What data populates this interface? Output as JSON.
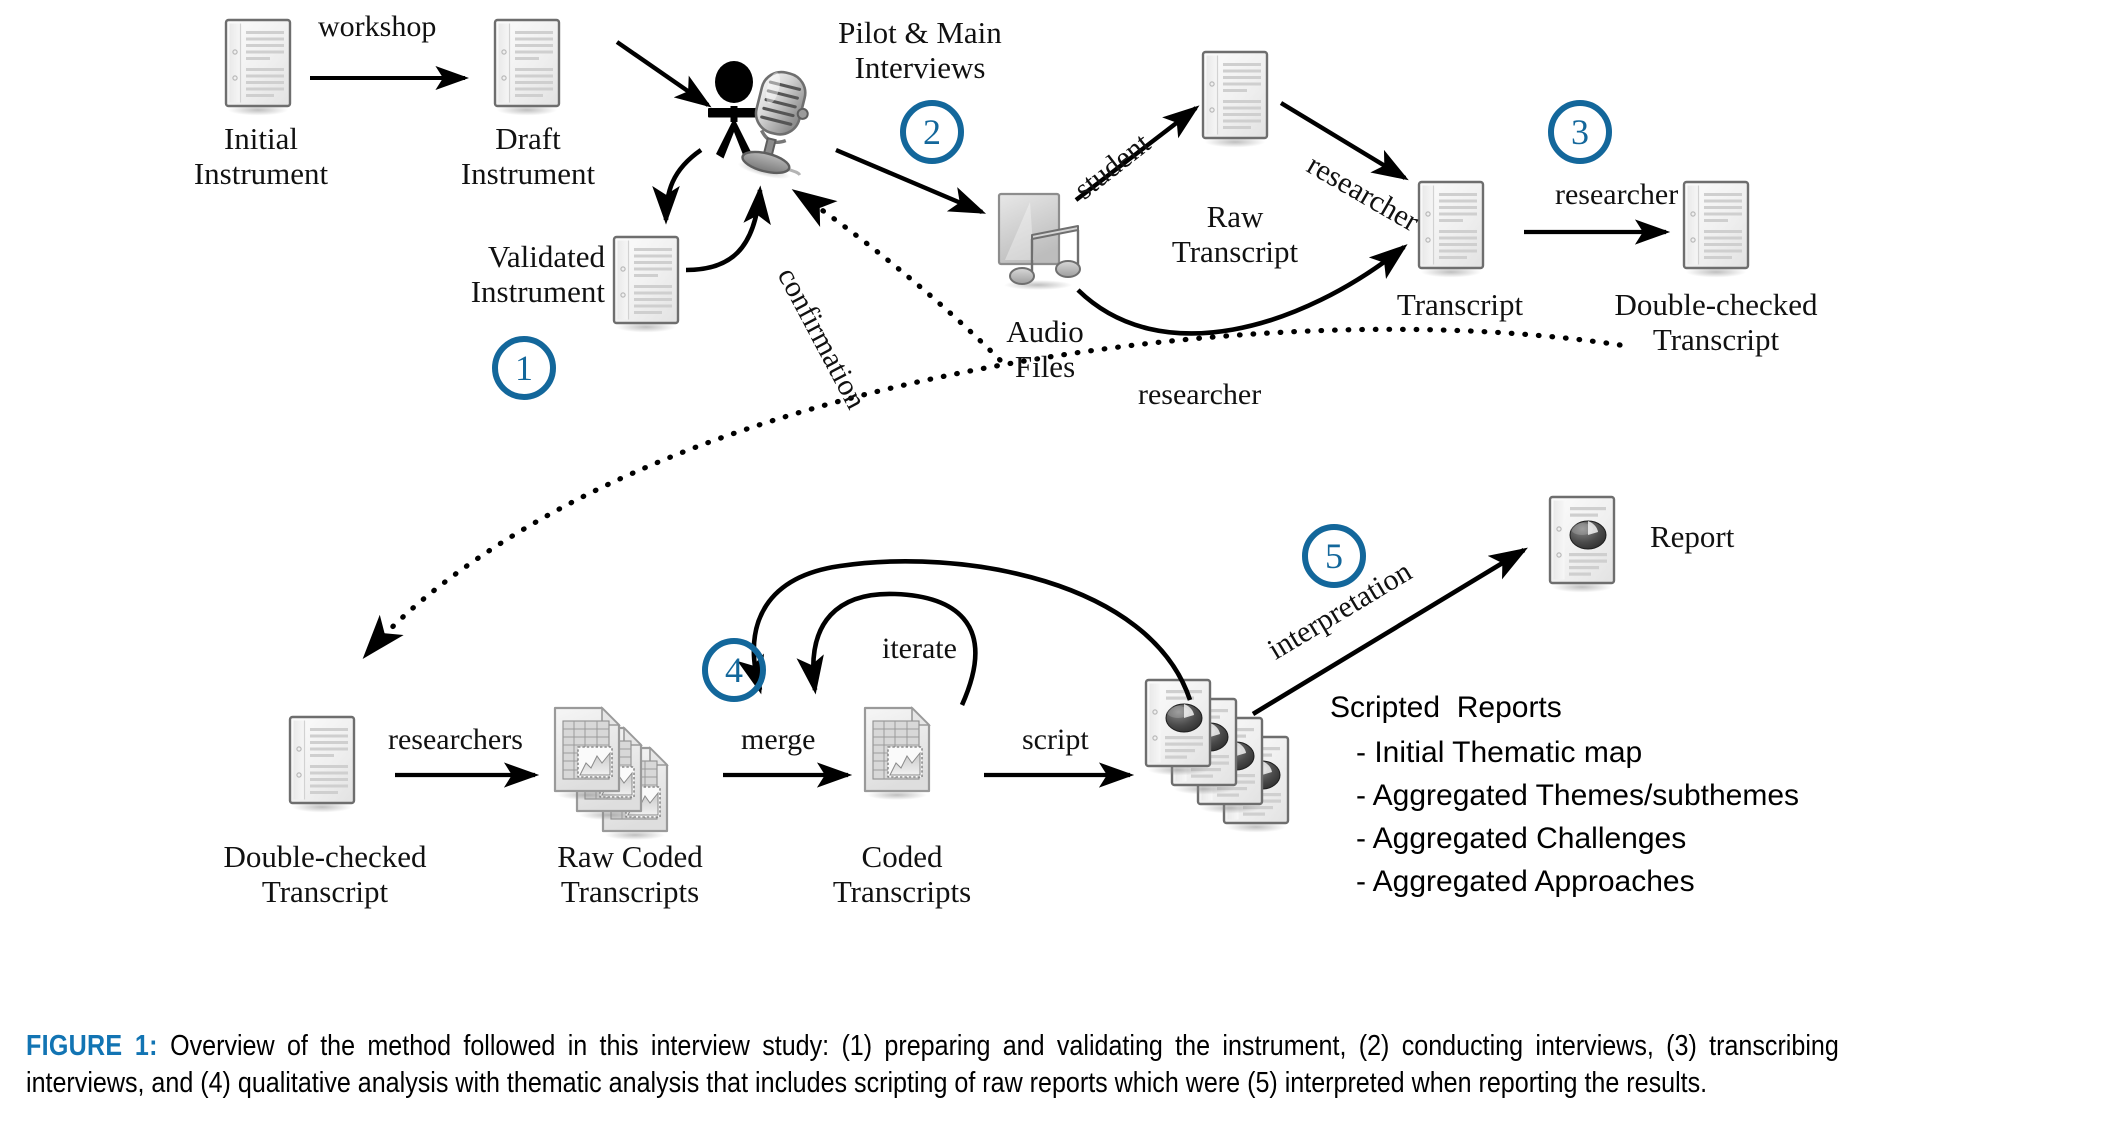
{
  "figure": {
    "label": "FIGURE 1:",
    "caption": " Overview of the method followed in this interview study: (1) preparing and validating the instrument, (2) conducting interviews, (3) transcribing interviews, and (4) qualitative analysis with thematic analysis that includes scripting of raw reports which were (5) interpreted when reporting the results.",
    "label_color": "#1274B3"
  },
  "colors": {
    "accent_blue": "#13679B",
    "stroke": "#000000",
    "doc_fill": "#f2f2f2",
    "doc_border": "#6b6b6b"
  },
  "steps": [
    {
      "id": "step-1",
      "number": "1"
    },
    {
      "id": "step-2",
      "number": "2"
    },
    {
      "id": "step-3",
      "number": "3"
    },
    {
      "id": "step-4",
      "number": "4"
    },
    {
      "id": "step-5",
      "number": "5"
    }
  ],
  "nodes": [
    {
      "id": "initial-instrument",
      "label": "Initial\nInstrument",
      "icon": "document-icon"
    },
    {
      "id": "draft-instrument",
      "label": "Draft\nInstrument",
      "icon": "document-icon"
    },
    {
      "id": "validated-instrument",
      "label": "Validated\nInstrument",
      "icon": "document-icon"
    },
    {
      "id": "interviewer",
      "label": "",
      "icon": "person-microphone-icon"
    },
    {
      "id": "pilot-main-interviews",
      "label": "Pilot & Main\nInterviews",
      "icon": ""
    },
    {
      "id": "audio-files",
      "label": "Audio\nFiles",
      "icon": "audio-file-icon"
    },
    {
      "id": "raw-transcript",
      "label": "Raw\nTranscript",
      "icon": "document-icon"
    },
    {
      "id": "transcript",
      "label": "Transcript",
      "icon": "document-icon"
    },
    {
      "id": "double-checked-transcript-top",
      "label": "Double-checked\nTranscript",
      "icon": "document-icon"
    },
    {
      "id": "double-checked-transcript-bottom",
      "label": "Double-checked\nTranscript",
      "icon": "document-icon"
    },
    {
      "id": "raw-coded-transcripts",
      "label": "Raw Coded\nTranscripts",
      "icon": "spreadsheet-stack-icon"
    },
    {
      "id": "coded-transcripts",
      "label": "Coded\nTranscripts",
      "icon": "spreadsheet-icon"
    },
    {
      "id": "scripted-reports-stack",
      "label": "",
      "icon": "report-stack-icon"
    },
    {
      "id": "report",
      "label": "Report",
      "icon": "report-icon"
    }
  ],
  "edges": [
    {
      "id": "edge-workshop",
      "label": "workshop",
      "style": "solid"
    },
    {
      "id": "edge-draft-to-person",
      "label": "",
      "style": "solid"
    },
    {
      "id": "edge-person-to-validated",
      "label": "",
      "style": "solid"
    },
    {
      "id": "edge-validated-to-person",
      "label": "",
      "style": "solid"
    },
    {
      "id": "edge-person-to-audio",
      "label": "",
      "style": "solid"
    },
    {
      "id": "edge-confirmation",
      "label": "confirmation",
      "style": "dotted"
    },
    {
      "id": "edge-student",
      "label": "student",
      "style": "solid"
    },
    {
      "id": "edge-researcher-raw-to-transcript",
      "label": "researcher",
      "style": "solid"
    },
    {
      "id": "edge-researcher-audio-to-transcript",
      "label": "researcher",
      "style": "solid"
    },
    {
      "id": "edge-researcher-doublecheck",
      "label": "researcher",
      "style": "solid"
    },
    {
      "id": "edge-dotted-return",
      "label": "",
      "style": "dotted"
    },
    {
      "id": "edge-researchers",
      "label": "researchers",
      "style": "solid"
    },
    {
      "id": "edge-merge",
      "label": "merge",
      "style": "solid"
    },
    {
      "id": "edge-iterate",
      "label": "iterate",
      "style": "solid"
    },
    {
      "id": "edge-script",
      "label": "script",
      "style": "solid"
    },
    {
      "id": "edge-interpretation",
      "label": "interpretation",
      "style": "solid"
    },
    {
      "id": "edge-loop-outer",
      "label": "",
      "style": "solid"
    },
    {
      "id": "edge-loop-inner",
      "label": "",
      "style": "solid"
    }
  ],
  "scripted_reports": {
    "title": "Scripted  Reports",
    "items": [
      "- Initial Thematic map",
      "- Aggregated Themes/subthemes",
      "- Aggregated Challenges",
      "- Aggregated Approaches"
    ]
  }
}
